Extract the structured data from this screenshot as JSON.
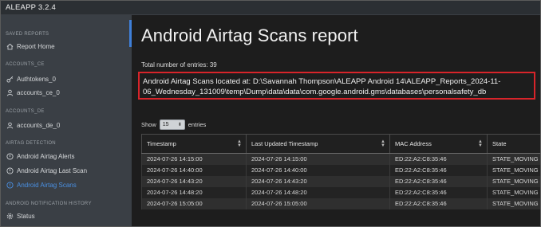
{
  "app": {
    "name": "ALEAPP 3.2.4"
  },
  "sidebar": {
    "sections": [
      {
        "heading": "SAVED REPORTS",
        "items": [
          {
            "label": "Report Home",
            "icon": "home-icon"
          }
        ]
      },
      {
        "heading": "ACCOUNTS_CE",
        "items": [
          {
            "label": "Authtokens_0",
            "icon": "key-icon"
          },
          {
            "label": "accounts_ce_0",
            "icon": "user-icon"
          }
        ]
      },
      {
        "heading": "ACCOUNTS_DE",
        "items": [
          {
            "label": "accounts_de_0",
            "icon": "user-icon"
          }
        ]
      },
      {
        "heading": "AIRTAG DETECTION",
        "items": [
          {
            "label": "Android Airtag Alerts",
            "icon": "alert-icon"
          },
          {
            "label": "Android Airtag Last Scan",
            "icon": "alert-icon"
          },
          {
            "label": "Android Airtag Scans",
            "icon": "alert-icon",
            "active": true
          }
        ]
      },
      {
        "heading": "ANDROID NOTIFICATION HISTORY",
        "items": [
          {
            "label": "Status",
            "icon": "gear-icon"
          }
        ]
      }
    ],
    "accent_color": "#4a90e2"
  },
  "main": {
    "title": "Android Airtag Scans report",
    "total_entries": "Total number of entries: 39",
    "location": "Android Airtag Scans located at: D:\\Savannah Thompson\\ALEAPP Android 14\\ALEAPP_Reports_2024-11-06_Wednesday_131009\\temp\\Dump\\data\\data\\com.google.android.gms\\databases\\personalsafety_db",
    "highlight_color": "#d8242a",
    "show_label": "Show",
    "entries_label": "entries",
    "entries_value": "15",
    "table": {
      "headers": [
        "Timestamp",
        "Last Updated Timestamp",
        "MAC Address",
        "State"
      ],
      "rows": [
        [
          "2024-07-26 14:15:00",
          "2024-07-26 14:15:00",
          "ED:22:A2:C8:35:46",
          "STATE_MOVING"
        ],
        [
          "2024-07-26 14:40:00",
          "2024-07-26 14:40:00",
          "ED:22:A2:C8:35:46",
          "STATE_MOVING"
        ],
        [
          "2024-07-26 14:43:20",
          "2024-07-26 14:43:20",
          "ED:22:A2:C8:35:46",
          "STATE_MOVING"
        ],
        [
          "2024-07-26 14:48:20",
          "2024-07-26 14:48:20",
          "ED:22:A2:C8:35:46",
          "STATE_MOVING"
        ],
        [
          "2024-07-26 15:05:00",
          "2024-07-26 15:05:00",
          "ED:22:A2:C8:35:46",
          "STATE_MOVING"
        ]
      ]
    }
  }
}
